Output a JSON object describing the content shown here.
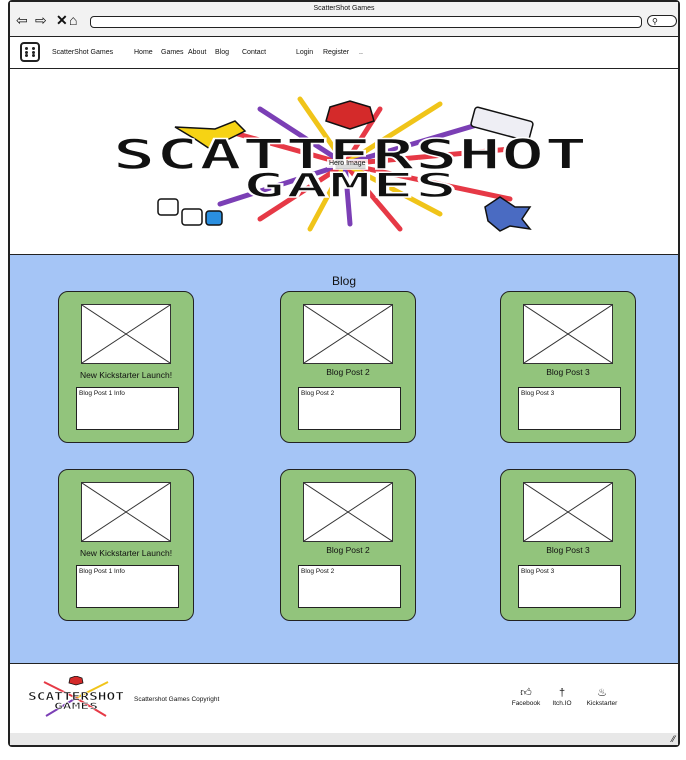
{
  "window": {
    "title": "ScatterShot Games"
  },
  "nav": {
    "brand": "ScatterShot Games",
    "links": [
      "Home",
      "Games",
      "About",
      "Blog",
      "Contact"
    ],
    "login": "Login",
    "register": "Register",
    "more": ".."
  },
  "hero": {
    "label": "Hero Image",
    "logo_line1": "SCATTERSHOT",
    "logo_line2": "GAMES"
  },
  "blog": {
    "heading": "Blog",
    "cards": [
      {
        "title": "New Kickstarter Launch!",
        "info": "Blog Post 1 Info"
      },
      {
        "title": "Blog Post 2",
        "info": "Blog Post 2"
      },
      {
        "title": "Blog Post 3",
        "info": "Blog Post 3"
      },
      {
        "title": "New Kickstarter Launch!",
        "info": "Blog Post 1 Info"
      },
      {
        "title": "Blog Post 2",
        "info": "Blog Post 2"
      },
      {
        "title": "Blog Post 3",
        "info": "Blog Post 3"
      }
    ]
  },
  "footer": {
    "logo_line1": "SCATTERSHOT",
    "logo_line2": "GAMES",
    "copyright": "Scattershot Games Copyright",
    "social": [
      {
        "label": "Facebook",
        "icon": "thumbs-up-icon"
      },
      {
        "label": "Itch.IO",
        "icon": "dagger-icon"
      },
      {
        "label": "Kickstarter",
        "icon": "flame-icon"
      }
    ]
  },
  "colors": {
    "blog_bg": "#a5c5f6",
    "card_bg": "#92c47c"
  }
}
